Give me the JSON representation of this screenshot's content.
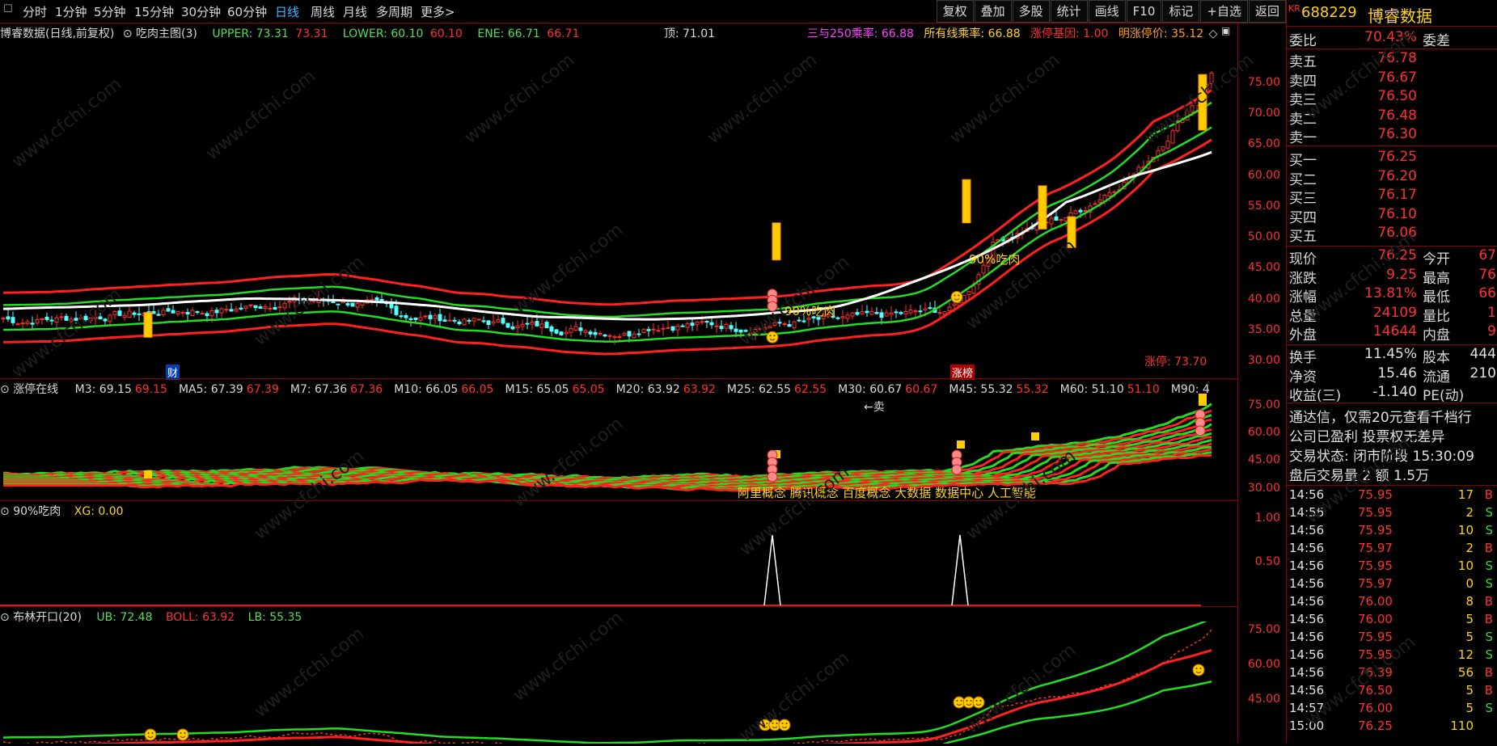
{
  "periods": [
    {
      "label": "分时"
    },
    {
      "label": "1分钟"
    },
    {
      "label": "5分钟"
    },
    {
      "label": "15分钟"
    },
    {
      "label": "30分钟"
    },
    {
      "label": "60分钟"
    },
    {
      "label": "日线",
      "active": true
    },
    {
      "label": "周线"
    },
    {
      "label": "月线"
    },
    {
      "label": "多周期"
    },
    {
      "label": "更多>"
    }
  ],
  "toolbar": [
    "复权",
    "叠加",
    "多股",
    "统计",
    "画线",
    "F10",
    "标记",
    "+自选",
    "返回"
  ],
  "main_pane": {
    "title": "博睿数据(日线,前复权)",
    "indicator": "吃肉主图(3)",
    "upper_label": "UPPER: 73.31",
    "upper_val": "73.31",
    "lower_label": "LOWER: 60.10",
    "lower_val": "60.10",
    "ene_label": "ENE: 66.71",
    "ene_val": "66.71",
    "top_label": "顶: 71.01",
    "sanyu": "三与250乘率: 66.88",
    "suoyou": "所有线乘率: 66.88",
    "zhangting_gene": "涨停基因: 1.00",
    "mingzhang": "明涨停价: 35.12",
    "ticks": [
      "75.00",
      "70.00",
      "65.00",
      "60.00",
      "55.00",
      "50.00",
      "45.00",
      "40.00",
      "35.00",
      "30.00"
    ],
    "annot_1": "90%吃肉",
    "annot_2": "90%吃肉",
    "cai_badge": "财",
    "zhangbang_badge": "涨榜",
    "limit_label": "涨停: 73.70"
  },
  "pane2": {
    "title": "涨停在线",
    "ma": [
      {
        "k": "M3: 69.15",
        "v": "69.15"
      },
      {
        "k": "MA5: 67.39",
        "v": "67.39"
      },
      {
        "k": "M7: 67.36",
        "v": "67.36"
      },
      {
        "k": "M10: 66.05",
        "v": "66.05"
      },
      {
        "k": "M15: 65.05",
        "v": "65.05"
      },
      {
        "k": "M20: 63.92",
        "v": "63.92"
      },
      {
        "k": "M25: 62.55",
        "v": "62.55"
      },
      {
        "k": "M30: 60.67",
        "v": "60.67"
      },
      {
        "k": "M45: 55.32",
        "v": "55.32"
      },
      {
        "k": "M60: 51.10",
        "v": "51.10"
      },
      {
        "k": "M90: 4",
        "v": ""
      }
    ],
    "sell_label": "←卖",
    "concepts": "阿里概念 腾讯概念 百度概念 大数据 数据中心 人工智能",
    "ticks": [
      "75.00",
      "60.00",
      "45.00",
      "30.00"
    ]
  },
  "pane3": {
    "title": "90%吃肉",
    "xg": "XG: 0.00",
    "ticks": [
      "1.00",
      "0.50"
    ]
  },
  "pane4": {
    "title": "布林开口(20)",
    "ub": "UB: 72.48",
    "boll": "BOLL: 63.92",
    "lb": "LB: 55.35",
    "ticks": [
      "75.00",
      "60.00",
      "45.00"
    ]
  },
  "quote": {
    "badge": "KR",
    "code": "688229",
    "name": "博睿数据",
    "weibi_k": "委比",
    "weibi_v": "70.43%",
    "weicha_k": "委差",
    "asks": [
      {
        "k": "卖五",
        "v": "76.78"
      },
      {
        "k": "卖四",
        "v": "76.67"
      },
      {
        "k": "卖三",
        "v": "76.50"
      },
      {
        "k": "卖二",
        "v": "76.48"
      },
      {
        "k": "卖一",
        "v": "76.30"
      }
    ],
    "bids": [
      {
        "k": "买一",
        "v": "76.25"
      },
      {
        "k": "买二",
        "v": "76.20"
      },
      {
        "k": "买三",
        "v": "76.17"
      },
      {
        "k": "买四",
        "v": "76.10"
      },
      {
        "k": "买五",
        "v": "76.06"
      }
    ],
    "stats": [
      {
        "k": "现价",
        "v": "76.25",
        "k2": "今开",
        "v2": "67"
      },
      {
        "k": "涨跌",
        "v": "9.25",
        "k2": "最高",
        "v2": "76"
      },
      {
        "k": "涨幅",
        "v": "13.81%",
        "k2": "最低",
        "v2": "66"
      },
      {
        "k": "总量",
        "v": "24109",
        "k2": "量比",
        "v2": "1"
      },
      {
        "k": "外盘",
        "v": "14644",
        "k2": "内盘",
        "v2": "9"
      }
    ],
    "stats2": [
      {
        "k": "换手",
        "v": "11.45%",
        "k2": "股本",
        "v2": "444"
      },
      {
        "k": "净资",
        "v": "15.46",
        "k2": "流通",
        "v2": "210"
      },
      {
        "k": "收益(三)",
        "v": "-1.140",
        "k2": "PE(动)",
        "v2": ""
      }
    ],
    "ad1": "通达信，仅需20元查看千档行",
    "ad2": "公司已盈利 投票权无差异",
    "trade_state": "交易状态: 闭市阶段 15:30:09",
    "after_hours": "盘后交易量 2 额 1.5万",
    "trades": [
      {
        "t": "14:56",
        "p": "75.95",
        "v": "17",
        "s": "B"
      },
      {
        "t": "14:56",
        "p": "75.95",
        "v": "2",
        "s": "S"
      },
      {
        "t": "14:56",
        "p": "75.95",
        "v": "10",
        "s": "S"
      },
      {
        "t": "14:56",
        "p": "75.97",
        "v": "2",
        "s": "B"
      },
      {
        "t": "14:56",
        "p": "75.95",
        "v": "10",
        "s": "S"
      },
      {
        "t": "14:56",
        "p": "75.97",
        "v": "0",
        "s": "S"
      },
      {
        "t": "14:56",
        "p": "76.00",
        "v": "8",
        "s": "B"
      },
      {
        "t": "14:56",
        "p": "76.00",
        "v": "5",
        "s": "B"
      },
      {
        "t": "14:56",
        "p": "75.95",
        "v": "5",
        "s": "S"
      },
      {
        "t": "14:56",
        "p": "75.95",
        "v": "12",
        "s": "S"
      },
      {
        "t": "14:56",
        "p": "76.39",
        "v": "56",
        "s": "B"
      },
      {
        "t": "14:56",
        "p": "76.50",
        "v": "5",
        "s": "B"
      },
      {
        "t": "14:57",
        "p": "76.00",
        "v": "5",
        "s": "S"
      },
      {
        "t": "15:00",
        "p": "76.25",
        "v": "110",
        "s": ""
      }
    ]
  },
  "watermark": "www.cfchi.com",
  "colors": {
    "up": "#ff3030",
    "down": "#55ffff",
    "green": "#33dd33",
    "white": "#ffffff",
    "yellow": "#ffd21a"
  }
}
